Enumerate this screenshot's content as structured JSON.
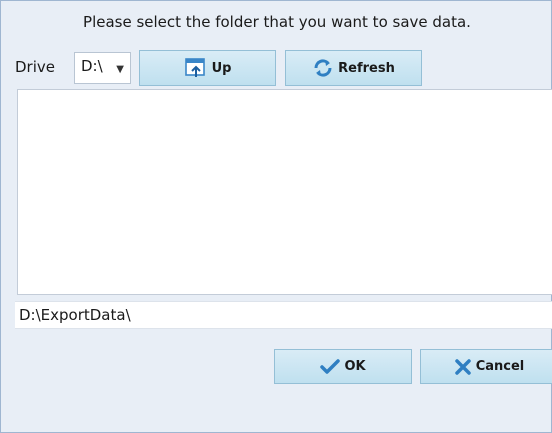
{
  "dialog": {
    "prompt": "Please select the folder that you want to save data."
  },
  "drive": {
    "label": "Drive",
    "selected": "D:\\"
  },
  "toolbar": {
    "up_label": "Up",
    "refresh_label": "Refresh"
  },
  "folder_list": {
    "items": []
  },
  "path": {
    "value": "D:\\ExportData\\"
  },
  "footer": {
    "ok_label": "OK",
    "cancel_label": "Cancel"
  },
  "icons": {
    "up": "folder-up-icon",
    "refresh": "refresh-icon",
    "ok": "checkmark-icon",
    "cancel": "x-icon",
    "caret": "chevron-down-icon"
  },
  "colors": {
    "dialog_bg": "#e8eef6",
    "button_bg": "#bfe0ef",
    "accent_blue": "#3a86c8"
  }
}
